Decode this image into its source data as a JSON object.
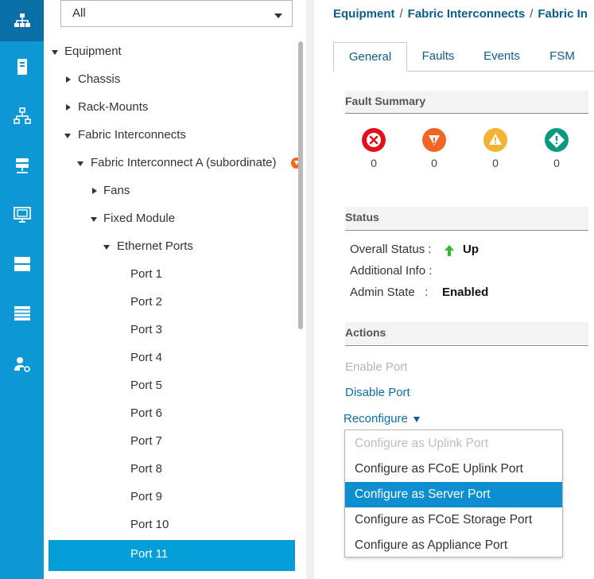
{
  "rail": {
    "items": [
      {
        "icon": "equipment-icon",
        "active": true
      },
      {
        "icon": "server-icon"
      },
      {
        "icon": "lan-icon"
      },
      {
        "icon": "san-icon"
      },
      {
        "icon": "vm-icon"
      },
      {
        "icon": "storage-icon"
      },
      {
        "icon": "chassis-list-icon"
      },
      {
        "icon": "admin-icon"
      }
    ]
  },
  "tree": {
    "filter_value": "All",
    "nodes": [
      {
        "label": "Equipment",
        "expanded": true
      },
      {
        "label": "Chassis",
        "expanded": false
      },
      {
        "label": "Rack-Mounts",
        "expanded": false
      },
      {
        "label": "Fabric Interconnects",
        "expanded": true
      },
      {
        "label": "Fabric Interconnect A (subordinate)",
        "expanded": true
      },
      {
        "label": "Fans",
        "expanded": false
      },
      {
        "label": "Fixed Module",
        "expanded": true
      },
      {
        "label": "Ethernet Ports",
        "expanded": true
      },
      {
        "label": "Port 1"
      },
      {
        "label": "Port 2"
      },
      {
        "label": "Port 3"
      },
      {
        "label": "Port 4"
      },
      {
        "label": "Port 5"
      },
      {
        "label": "Port 6"
      },
      {
        "label": "Port 7"
      },
      {
        "label": "Port 8"
      },
      {
        "label": "Port 9"
      },
      {
        "label": "Port 10"
      },
      {
        "label": "Port 11",
        "selected": true
      }
    ]
  },
  "breadcrumb": {
    "items": [
      "Equipment",
      "Fabric Interconnects",
      "Fabric In"
    ],
    "separator": "/"
  },
  "tabs": [
    {
      "label": "General",
      "active": true
    },
    {
      "label": "Faults"
    },
    {
      "label": "Events"
    },
    {
      "label": "FSM"
    }
  ],
  "fault_summary": {
    "title": "Fault Summary",
    "counts": [
      {
        "icon": "critical-fault-icon",
        "value": "0",
        "color": "#e3101b"
      },
      {
        "icon": "major-fault-icon",
        "value": "0",
        "color": "#f26522"
      },
      {
        "icon": "minor-fault-icon",
        "value": "0",
        "color": "#f5b335"
      },
      {
        "icon": "warning-fault-icon",
        "value": "0",
        "color": "#079a7f"
      }
    ]
  },
  "status": {
    "title": "Status",
    "overall_label": "Overall Status",
    "overall_value": "Up",
    "additional_label": "Additional Info",
    "admin_label": "Admin State",
    "admin_value": "Enabled",
    "colon": ":"
  },
  "actions": {
    "title": "Actions",
    "enable_port": "Enable Port",
    "disable_port": "Disable Port",
    "reconfigure": "Reconfigure"
  },
  "reconfigure_menu": {
    "items": [
      {
        "label": "Configure as Uplink Port",
        "disabled": true
      },
      {
        "label": "Configure as FCoE Uplink Port"
      },
      {
        "label": "Configure as Server Port",
        "highlighted": true
      },
      {
        "label": "Configure as FCoE Storage Port"
      },
      {
        "label": "Configure as Appliance Port"
      }
    ]
  },
  "colors": {
    "rail_bg": "#0d98d3",
    "selection": "#049fd9",
    "link": "#0b5e8a",
    "status_up": "#2dbe2d"
  }
}
